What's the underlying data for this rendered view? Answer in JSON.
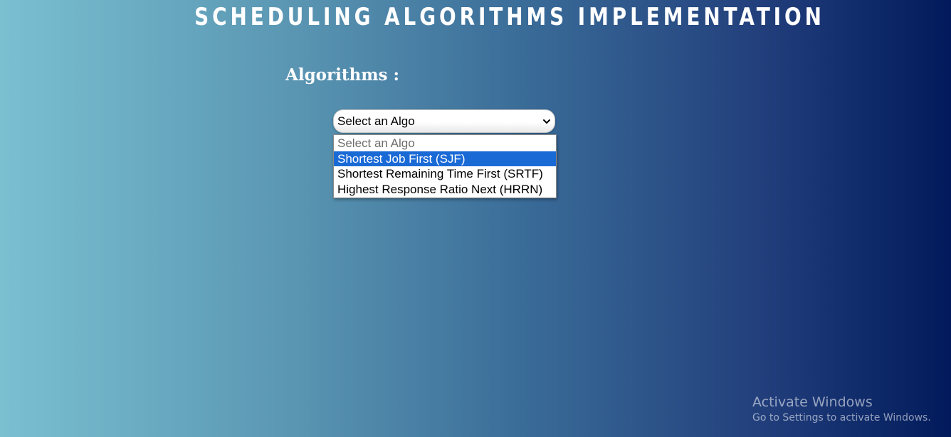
{
  "page": {
    "title": "SCHEDULING ALGORITHMS IMPLEMENTATION",
    "section_label": "Algorithms :"
  },
  "algo_select": {
    "selected_value": "Select an Algo",
    "options": [
      "Select an Algo",
      "Shortest Job First (SJF)",
      "Shortest Remaining Time First (SRTF)",
      "Highest Response Ratio Next (HRRN)"
    ],
    "highlighted_index": 1
  },
  "watermark": {
    "title": "Activate Windows",
    "subtitle": "Go to Settings to activate Windows."
  },
  "colors": {
    "gradient_start": "#7ac0d1",
    "gradient_end": "#011a5b",
    "highlight": "#1a6ad6"
  },
  "icons": {
    "select_arrow": "chevron-down-icon"
  }
}
